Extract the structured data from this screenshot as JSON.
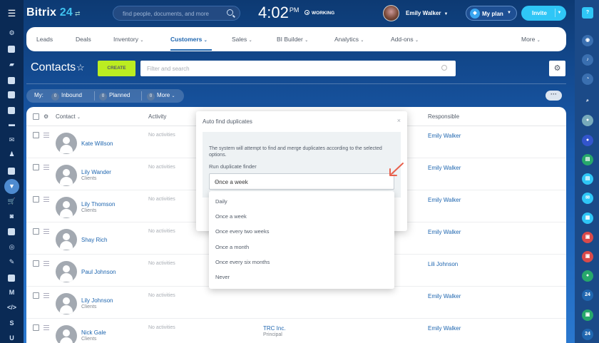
{
  "topbar": {
    "logo_brand": "Bitrix",
    "logo_number": "24",
    "logo_swap": "⇄",
    "search_placeholder": "find people, documents, and more",
    "clock_time": "4:02",
    "clock_ampm": "PM",
    "working_status": "WORKING",
    "user_name": "Emily Walker",
    "plan_label": "My plan",
    "invite_label": "Invite"
  },
  "nav": {
    "items": [
      {
        "label": "Leads"
      },
      {
        "label": "Deals"
      },
      {
        "label": "Inventory"
      },
      {
        "label": "Customers"
      },
      {
        "label": "Sales"
      },
      {
        "label": "BI Builder"
      },
      {
        "label": "Analytics"
      },
      {
        "label": "Add-ons"
      },
      {
        "label": "More"
      }
    ],
    "active": "Customers"
  },
  "page": {
    "title": "Contacts",
    "create_label": "CREATE",
    "filter_placeholder": "Filter and search"
  },
  "counters": {
    "my_label": "My:",
    "inbound_count": "0",
    "inbound_label": "Inbound",
    "planned_count": "0",
    "planned_label": "Planned",
    "more_count": "0",
    "more_label": "More"
  },
  "table": {
    "headers": {
      "contact": "Contact",
      "activity": "Activity",
      "responsible": "Responsible"
    },
    "rows": [
      {
        "name": "Kate Willson",
        "sub": "",
        "activity": "No activities",
        "company": "",
        "company_sub": "",
        "responsible": "Emily Walker"
      },
      {
        "name": "Lily Wander",
        "sub": "Clients",
        "activity": "No activities",
        "company": "",
        "company_sub": "",
        "responsible": "Emily Walker"
      },
      {
        "name": "Lily Thomson",
        "sub": "Clients",
        "activity": "No activities",
        "company": "",
        "company_sub": "",
        "responsible": "Emily Walker"
      },
      {
        "name": "Shay Rich",
        "sub": "",
        "activity": "No activities",
        "company": "",
        "company_sub": "",
        "responsible": "Emily Walker"
      },
      {
        "name": "Paul Johnson",
        "sub": "",
        "activity": "No activities",
        "company": "",
        "company_sub": "",
        "responsible": "Lili Johnson"
      },
      {
        "name": "Lily Johnson",
        "sub": "Clients",
        "activity": "No activities",
        "company": "",
        "company_sub": "",
        "responsible": "Emily Walker"
      },
      {
        "name": "Nick Gale",
        "sub": "Clients",
        "activity": "No activities",
        "company": "TRC Inc.",
        "company_sub": "Principal",
        "responsible": "Emily Walker"
      }
    ]
  },
  "popup": {
    "title": "Auto find duplicates",
    "close": "×",
    "description": "The system will attempt to find and merge duplicates according to the selected options.",
    "run_label": "Run duplicate finder",
    "selected": "Once a week",
    "options": [
      "Daily",
      "Once a week",
      "Once every two weeks",
      "Once a month",
      "Once every six months",
      "Never"
    ]
  },
  "right_rail": {
    "items": [
      "24",
      "24"
    ]
  },
  "left_rail": {
    "letters": [
      "S",
      "U"
    ]
  },
  "colors": {
    "accent": "#2067b0",
    "create_button": "#bbed21",
    "invite_button": "#2fc6f6",
    "arrow": "#e8604c"
  }
}
